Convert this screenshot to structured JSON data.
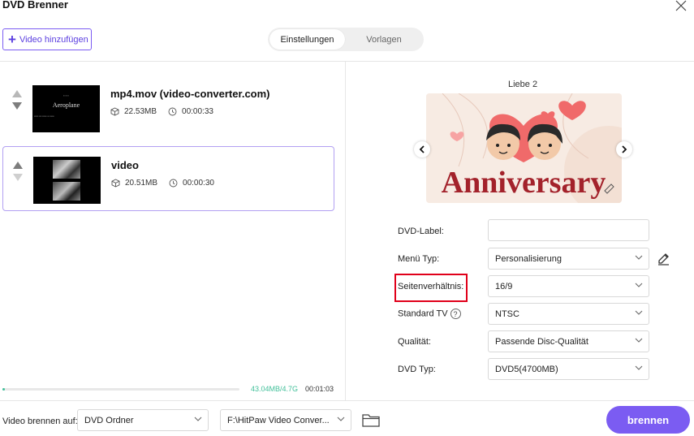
{
  "window": {
    "title": "DVD Brenner",
    "close_icon": "close-icon"
  },
  "toolbar": {
    "add_video_label": "Video hinzufügen",
    "tabs": [
      {
        "label": "Einstellungen",
        "active": true
      },
      {
        "label": "Vorlagen",
        "active": false
      }
    ]
  },
  "videos": [
    {
      "name": "mp4.mov (video-converter.com)",
      "size": "22.53MB",
      "duration": "00:00:33",
      "thumb_title": "Aeroplane",
      "selected": false
    },
    {
      "name": "video",
      "size": "20.51MB",
      "duration": "00:00:30",
      "selected": true
    }
  ],
  "usage": {
    "size_text": "43.04MB/4.7G",
    "duration_text": "00:01:03",
    "progress_fraction": 0.009
  },
  "preview": {
    "menu_name": "Liebe 2",
    "banner_text": "Anniversary"
  },
  "settings": {
    "dvd_label": {
      "label": "DVD-Label:",
      "value": ""
    },
    "menu_type": {
      "label": "Menü Typ:",
      "value": "Personalisierung"
    },
    "aspect": {
      "label": "Seitenverhältnis:",
      "value": "16/9"
    },
    "tv_standard": {
      "label": "Standard TV",
      "value": "NTSC",
      "help": "?"
    },
    "quality": {
      "label": "Qualität:",
      "value": "Passende Disc-Qualität"
    },
    "dvd_type": {
      "label": "DVD Typ:",
      "value": "DVD5(4700MB)"
    }
  },
  "footer": {
    "burn_to_label": "Video brennen auf:",
    "target_value": "DVD Ordner",
    "path_value": "F:\\HitPaw Video Conver...",
    "burn_button": "brennen"
  },
  "colors": {
    "accent": "#7b5cf2",
    "progress": "#42c09a",
    "highlight": "#e0001a"
  }
}
